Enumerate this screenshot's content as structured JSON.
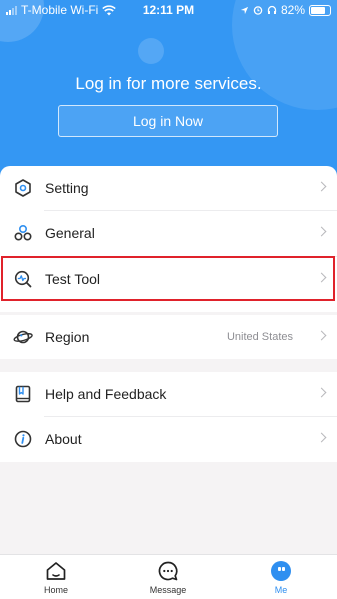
{
  "status_bar": {
    "carrier": "T-Mobile Wi-Fi",
    "time": "12:11 PM",
    "battery": "82%"
  },
  "header": {
    "login_prompt": "Log in for more services.",
    "login_button": "Log in Now"
  },
  "menu": {
    "setting": "Setting",
    "general": "General",
    "test_tool": "Test Tool",
    "region": "Region",
    "region_value": "United States",
    "help": "Help and Feedback",
    "about": "About"
  },
  "tabs": {
    "home": "Home",
    "message": "Message",
    "me": "Me"
  },
  "colors": {
    "brand": "#3497f3",
    "highlight": "#e0222b",
    "active_tab": "#2f8ff0"
  }
}
